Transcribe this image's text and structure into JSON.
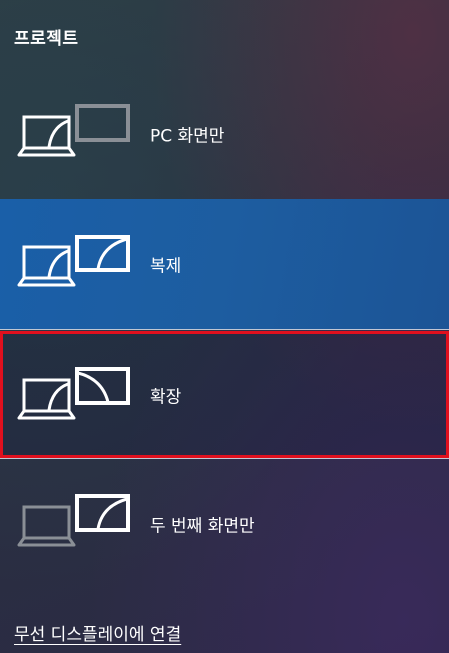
{
  "panel": {
    "title": "프로젝트"
  },
  "modes": [
    {
      "id": "pc-screen-only",
      "label": "PC 화면만",
      "selected": false,
      "icon": "pc-screen-only-icon"
    },
    {
      "id": "duplicate",
      "label": "복제",
      "selected": true,
      "icon": "duplicate-icon"
    },
    {
      "id": "extend",
      "label": "확장",
      "selected": false,
      "focused": true,
      "icon": "extend-icon"
    },
    {
      "id": "second-screen-only",
      "label": "두 번째 화면만",
      "selected": false,
      "icon": "second-screen-only-icon"
    }
  ],
  "footer": {
    "connect_label": "무선 디스플레이에 연결"
  },
  "colors": {
    "selected_background": "#1a5fa8",
    "focus_border": "#e0101e",
    "icon_active": "#ffffff",
    "icon_dimmed": "#8a8f96"
  }
}
